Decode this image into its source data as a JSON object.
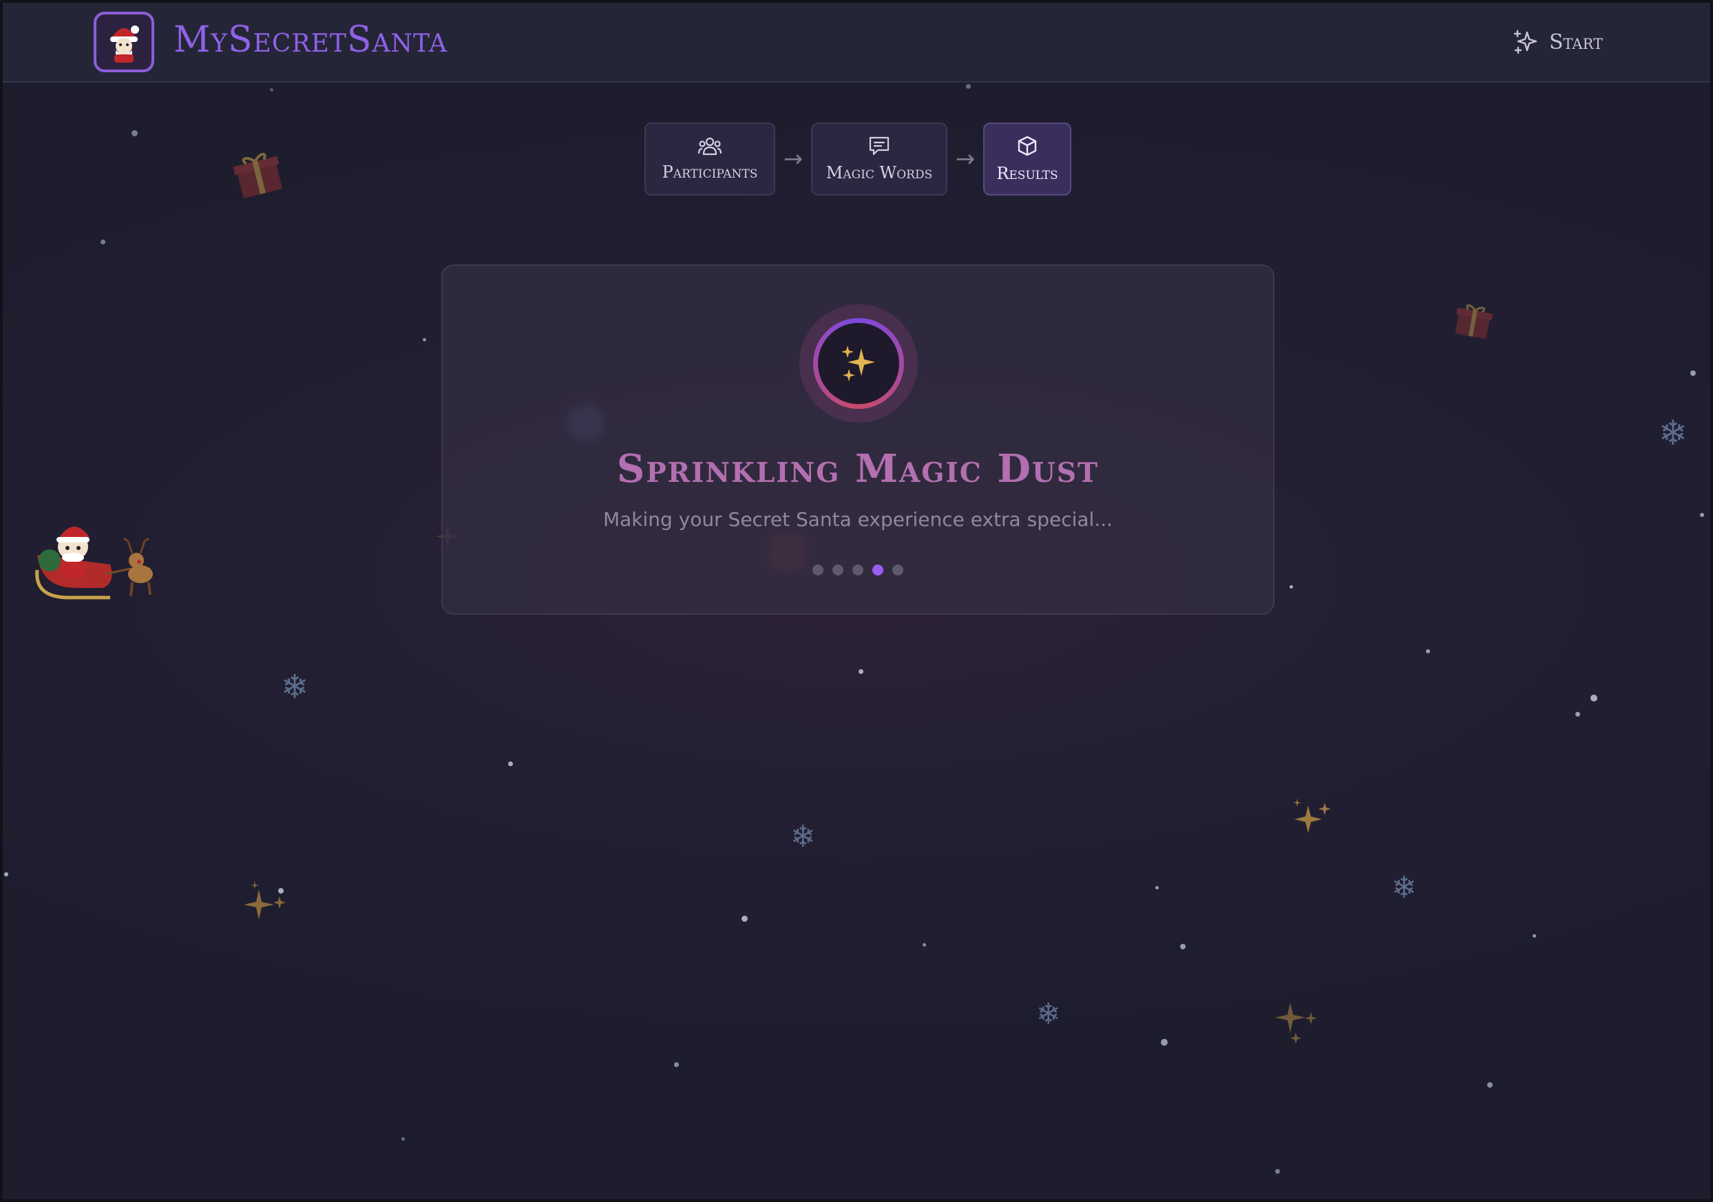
{
  "header": {
    "brand": "MySecretSanta",
    "start_label": "Start",
    "logo_icon": "santa-logo-icon",
    "start_icon": "sparkles-icon"
  },
  "steps": [
    {
      "label": "Participants",
      "icon": "users-icon",
      "active": false
    },
    {
      "label": "Magic Words",
      "icon": "message-icon",
      "active": false
    },
    {
      "label": "Results",
      "icon": "box-icon",
      "active": true
    }
  ],
  "loading_card": {
    "title": "Sprinkling Magic Dust",
    "subtitle": "Making your Secret Santa experience extra special...",
    "icon": "sparkles-icon",
    "progress": {
      "total_dots": 5,
      "active_dot": 4
    }
  },
  "colors": {
    "accent": "#8f62e6",
    "title": "#b36fb0",
    "background": "#1d1d2e",
    "sparkle": "#c9a24a",
    "snowflake": "#5c6d8c"
  }
}
